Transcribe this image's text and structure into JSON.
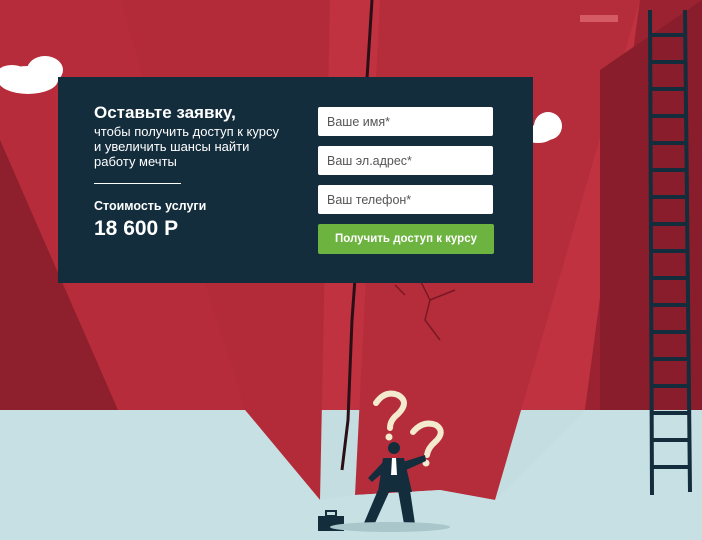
{
  "form": {
    "heading": "Оставьте заявку,",
    "subtext": "чтобы получить доступ к курсу и увеличить шансы найти работу мечты",
    "price_label": "Стоимость услуги",
    "price_value": "18 600 Р",
    "name_placeholder": "Ваше имя*",
    "email_placeholder": "Ваш эл.адрес*",
    "phone_placeholder": "Ваш телефон*",
    "submit_label": "Получить доступ к курсу"
  },
  "colors": {
    "wall": "#b72c3a",
    "wall_dark": "#8e1f2d",
    "floor": "#c3dde0",
    "card_bg": "#132d3d",
    "button": "#6db33f"
  },
  "illustration": {
    "elements": [
      "cloud-icon",
      "ladder-icon",
      "businessman-icon",
      "question-mark-icon",
      "briefcase-icon"
    ]
  }
}
